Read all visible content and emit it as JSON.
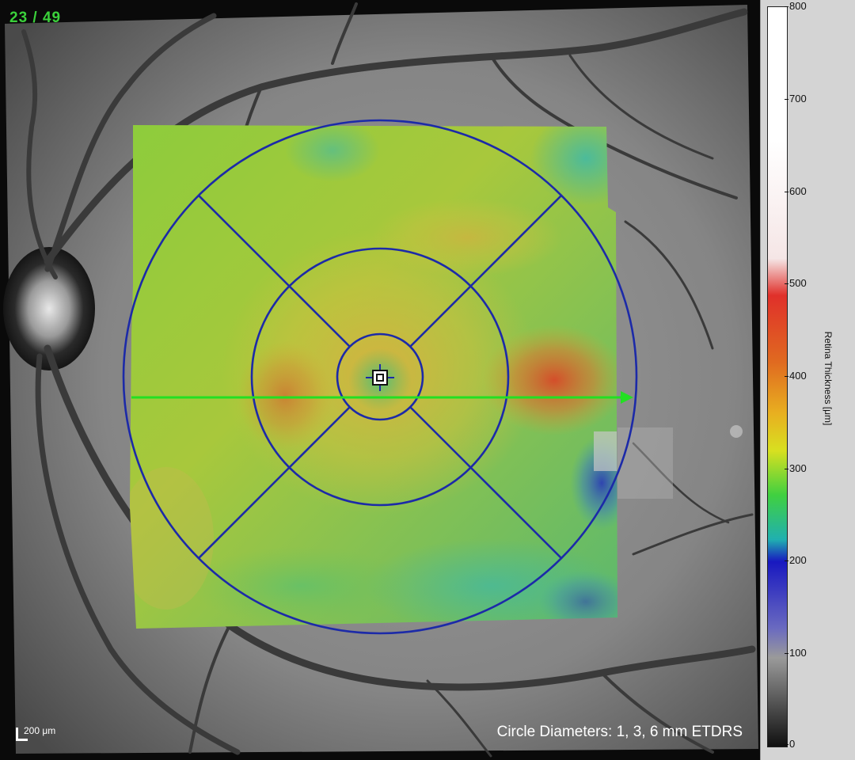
{
  "viewer": {
    "frame_counter": "23 / 49",
    "circle_caption": "Circle Diameters: 1, 3, 6 mm ETDRS",
    "scale_label": "200 μm"
  },
  "legend": {
    "title": "Retina Thickness [μm]",
    "ticks": [
      "800",
      "700",
      "600",
      "500",
      "400",
      "300",
      "200",
      "100",
      "0"
    ]
  },
  "colors": {
    "frame_counter": "#3bd13b",
    "etdrs_grid": "#1c2aa8",
    "scan_line": "#22e022"
  }
}
